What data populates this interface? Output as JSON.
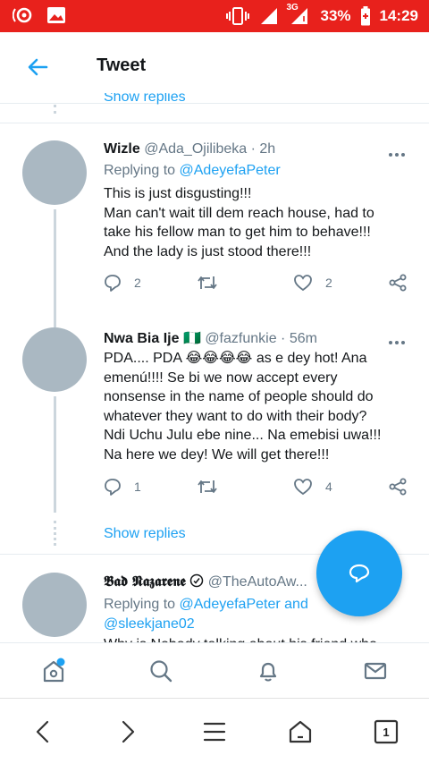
{
  "status_bar": {
    "network": "3G",
    "battery": "33%",
    "time": "14:29",
    "icons": [
      "notification-icon",
      "image-icon",
      "vibrate-icon",
      "signal-icon",
      "battery-charging-icon"
    ]
  },
  "header": {
    "title": "Tweet"
  },
  "peek": {
    "show_replies": "Show replies"
  },
  "tweets": [
    {
      "name": "Wizle",
      "handle": "@Ada_Ojilibeka",
      "time": "· 2h",
      "replying_prefix": "Replying to ",
      "replying_to": "@AdeyefaPeter",
      "lines": [
        "This is just disgusting!!!",
        "Man can't wait till dem reach house, had to",
        "take his fellow man to get him to behave!!!",
        "And the lady is just stood there!!!"
      ],
      "replies": "2",
      "likes": "2"
    },
    {
      "name": "Nwa Bia Ije",
      "flag": "🇳🇬",
      "handle": "@fazfunkie",
      "time": "· 56m",
      "lines": [
        "PDA....  PDA 😂😂😂😂 as e dey hot! Ana",
        "emenú!!!! Se bi we now accept every",
        "nonsense in the name of people should do",
        "whatever they want to do with their body?",
        "Ndi Uchu Julu ebe nine... Na emebisi uwa!!!",
        "Na here we dey! We will get there!!!"
      ],
      "replies": "1",
      "likes": "4",
      "show_replies": "Show replies"
    },
    {
      "name": "𝕭𝖆𝖉 𝕹𝖆𝖟𝖆𝖗𝖊𝖓𝖊",
      "handle": "@TheAutoAw...",
      "replying_prefix": "Replying to ",
      "replying_to": "@AdeyefaPeter",
      "replying_and": " and",
      "replying_to_2": "@sleekjane02",
      "first_line": "Why is Nobody talking about his friend who"
    }
  ],
  "colors": {
    "accent": "#1da1f2",
    "status_bar": "#e8211c",
    "avatar": "#aab8c2"
  },
  "tab_count": "1"
}
